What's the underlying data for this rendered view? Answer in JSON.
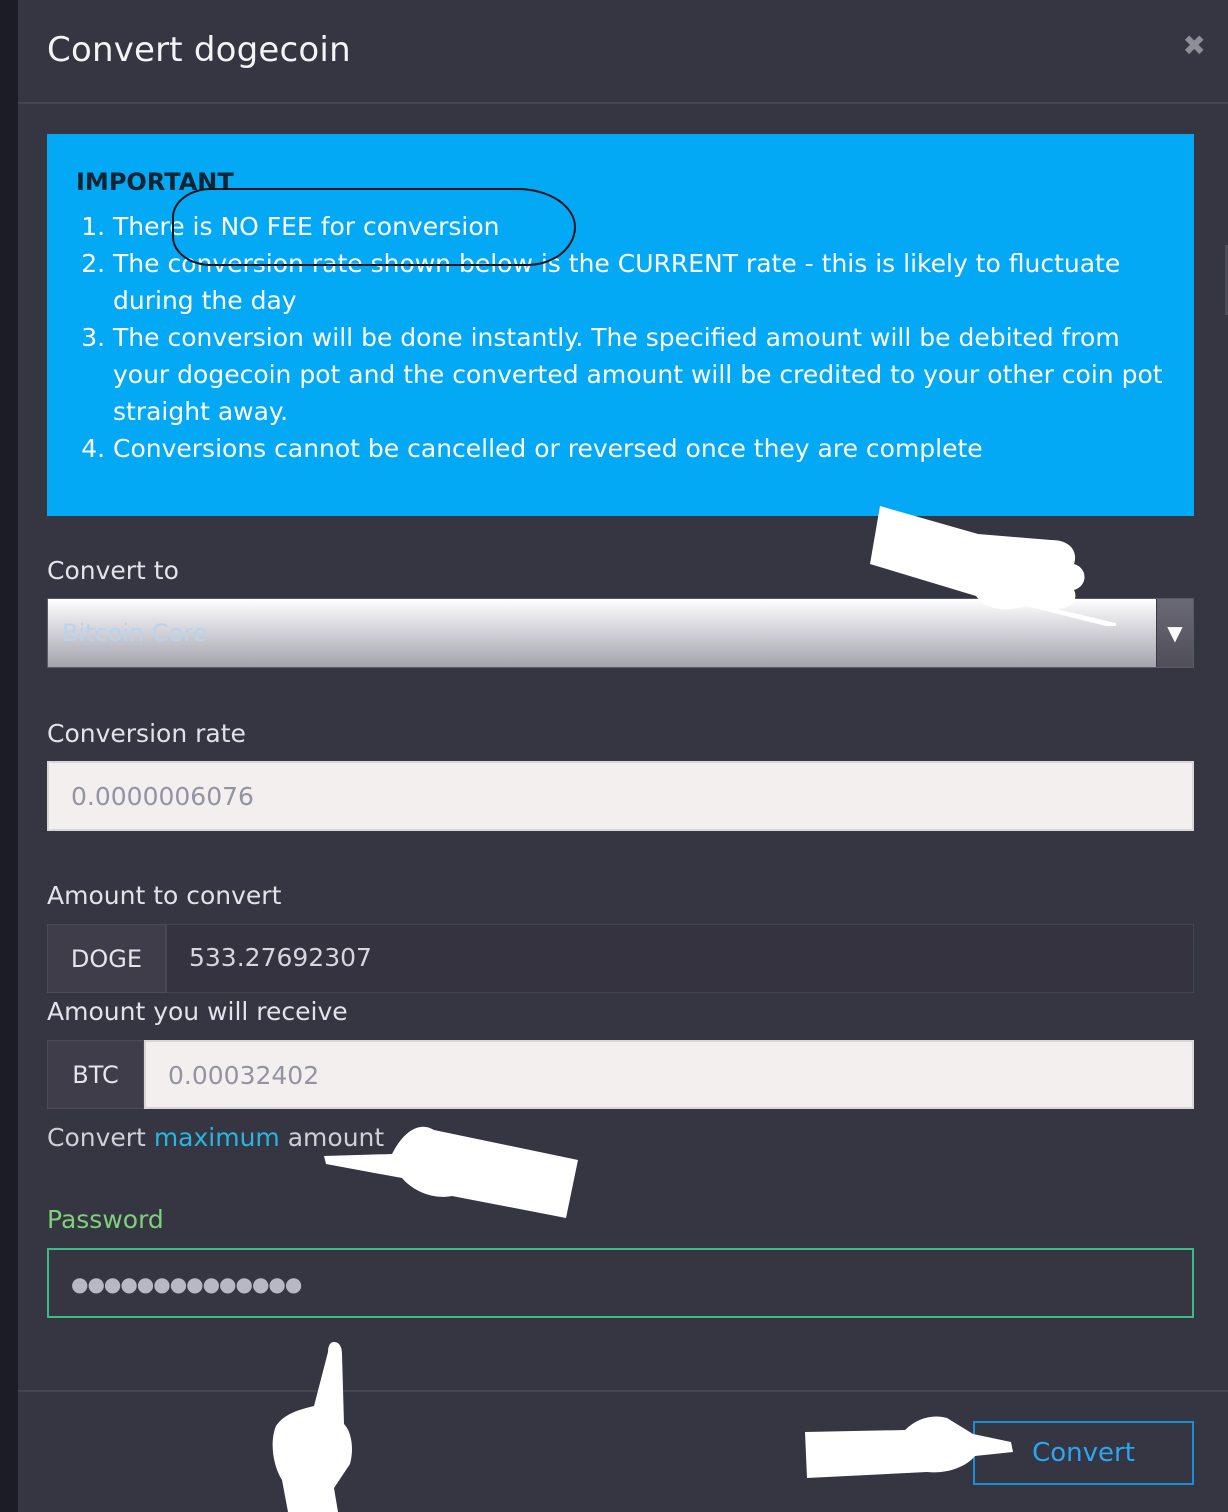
{
  "modal": {
    "title": "Convert dogecoin",
    "close_icon": "close-icon"
  },
  "notice": {
    "heading": "IMPORTANT",
    "items": [
      "There is NO FEE for conversion",
      "The conversion rate shown below is the CURRENT rate - this is likely to fluctuate during the day",
      "The conversion will be done instantly. The specified amount will be debited from your dogecoin pot and the converted amount will be credited to your other coin pot straight away.",
      "Conversions cannot be cancelled or reversed once they are complete"
    ],
    "background_color": "#03a9f4"
  },
  "form": {
    "convert_to_label": "Convert to",
    "convert_to_value": "Bitcoin Core",
    "conversion_rate_label": "Conversion rate",
    "conversion_rate_value": "0.0000006076",
    "amount_label": "Amount to convert",
    "amount_currency": "DOGE",
    "amount_value": "533.27692307",
    "receive_label": "Amount you will receive",
    "receive_currency": "BTC",
    "receive_value": "0.00032402",
    "convert_max_prefix": "Convert ",
    "convert_max_link": "maximum",
    "convert_max_suffix": " amount",
    "password_label": "Password",
    "password_mask": "●●●●●●●●●●●●●●"
  },
  "footer": {
    "convert_button": "Convert"
  },
  "colors": {
    "modal_bg": "#363542",
    "accent_blue": "#1a8fd8",
    "password_green": "#7ed07a",
    "link_cyan": "#28b6e0"
  }
}
